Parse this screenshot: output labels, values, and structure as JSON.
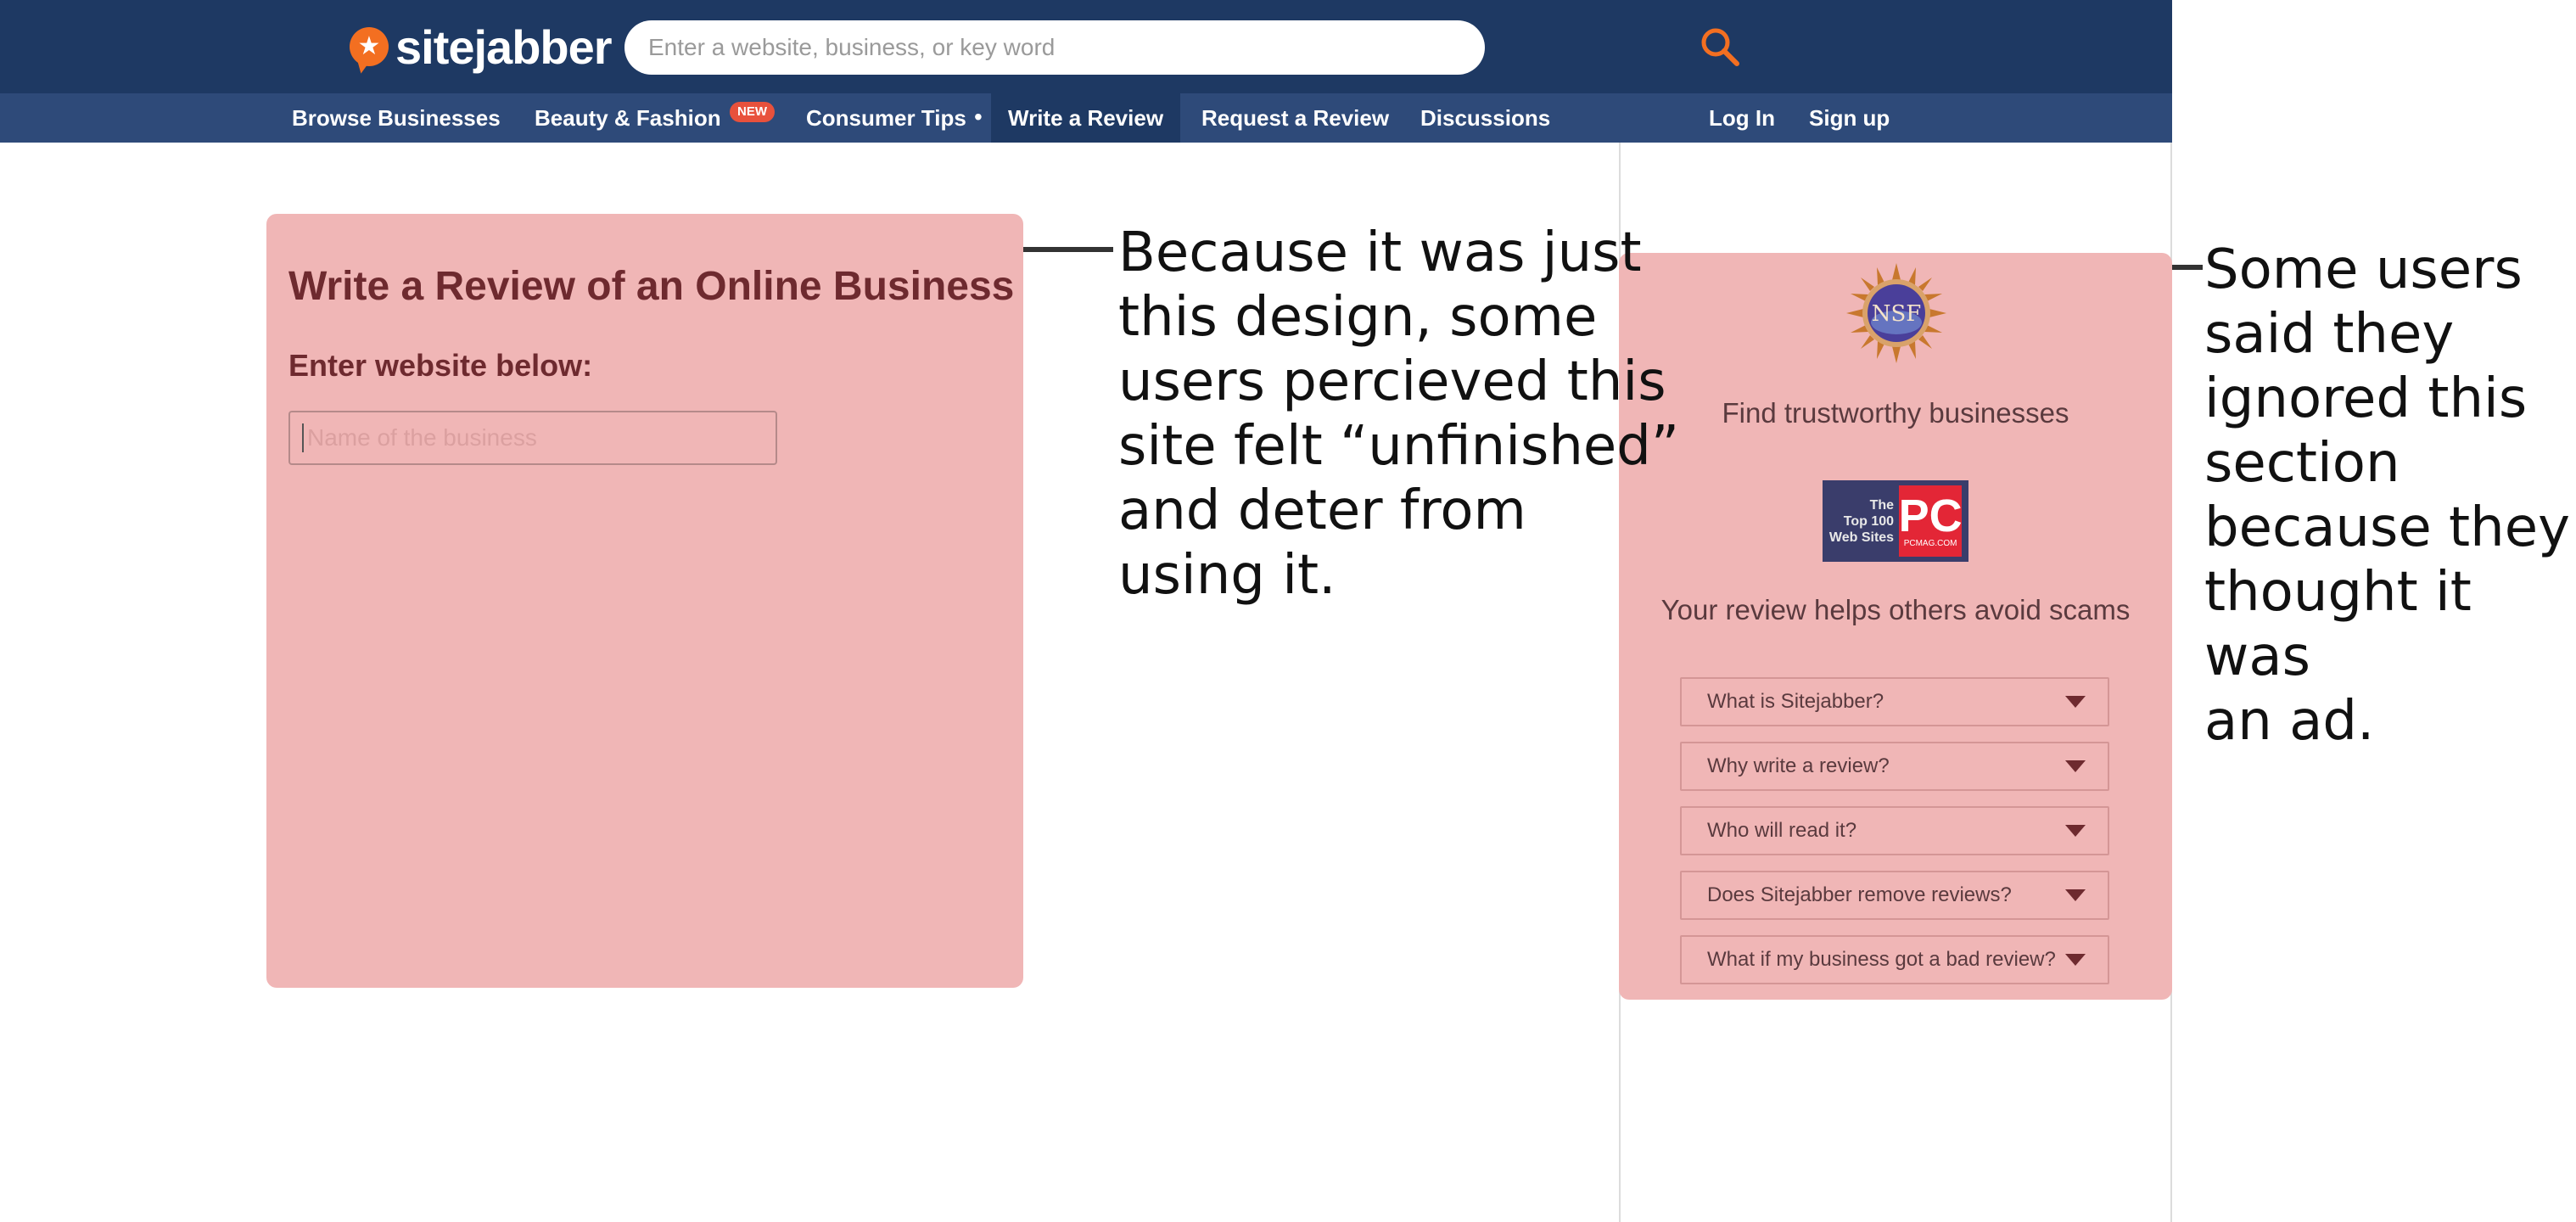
{
  "header": {
    "logo_text": "sitejabber",
    "search_placeholder": "Enter a website, business, or key word"
  },
  "nav": {
    "items": [
      "Browse Businesses",
      "Beauty & Fashion",
      "Consumer Tips",
      "Write a Review",
      "Request a Review",
      "Discussions"
    ],
    "badge": "NEW",
    "separator": "•",
    "login": "Log In",
    "signup": "Sign up",
    "active": "Write a Review"
  },
  "review_form": {
    "title": "Write a Review of an Online Business",
    "label": "Enter website below:",
    "input_placeholder": "Name of the business"
  },
  "sidebar": {
    "nsf_label": "NSF",
    "heading1": "Find trustworthy businesses",
    "pc_logo": {
      "words": [
        "The",
        "Top 100",
        "Web Sites"
      ],
      "letters": "PC",
      "site": "PCMAG.COM"
    },
    "heading2": "Your review helps others avoid scams",
    "faqs": [
      "What is Sitejabber?",
      "Why write a review?",
      "Who will read it?",
      "Does Sitejabber remove reviews?",
      "What if my business got a bad review?"
    ]
  },
  "annotations": {
    "left": [
      "Because it was just",
      "this design, some",
      "users percieved this",
      "site felt “unfinished”",
      "and deter from",
      "using it."
    ],
    "right": [
      "Some users",
      "said they",
      "ignored this",
      "section",
      "because they",
      "thought it was",
      "an ad."
    ]
  },
  "colors": {
    "header_bg": "#1e3963",
    "nav_bg": "#2e4a79",
    "brand_orange": "#f36f21",
    "panel_pink": "#f0b6b6",
    "panel_text": "#6e2a2f",
    "badge_red": "#e8513c"
  }
}
